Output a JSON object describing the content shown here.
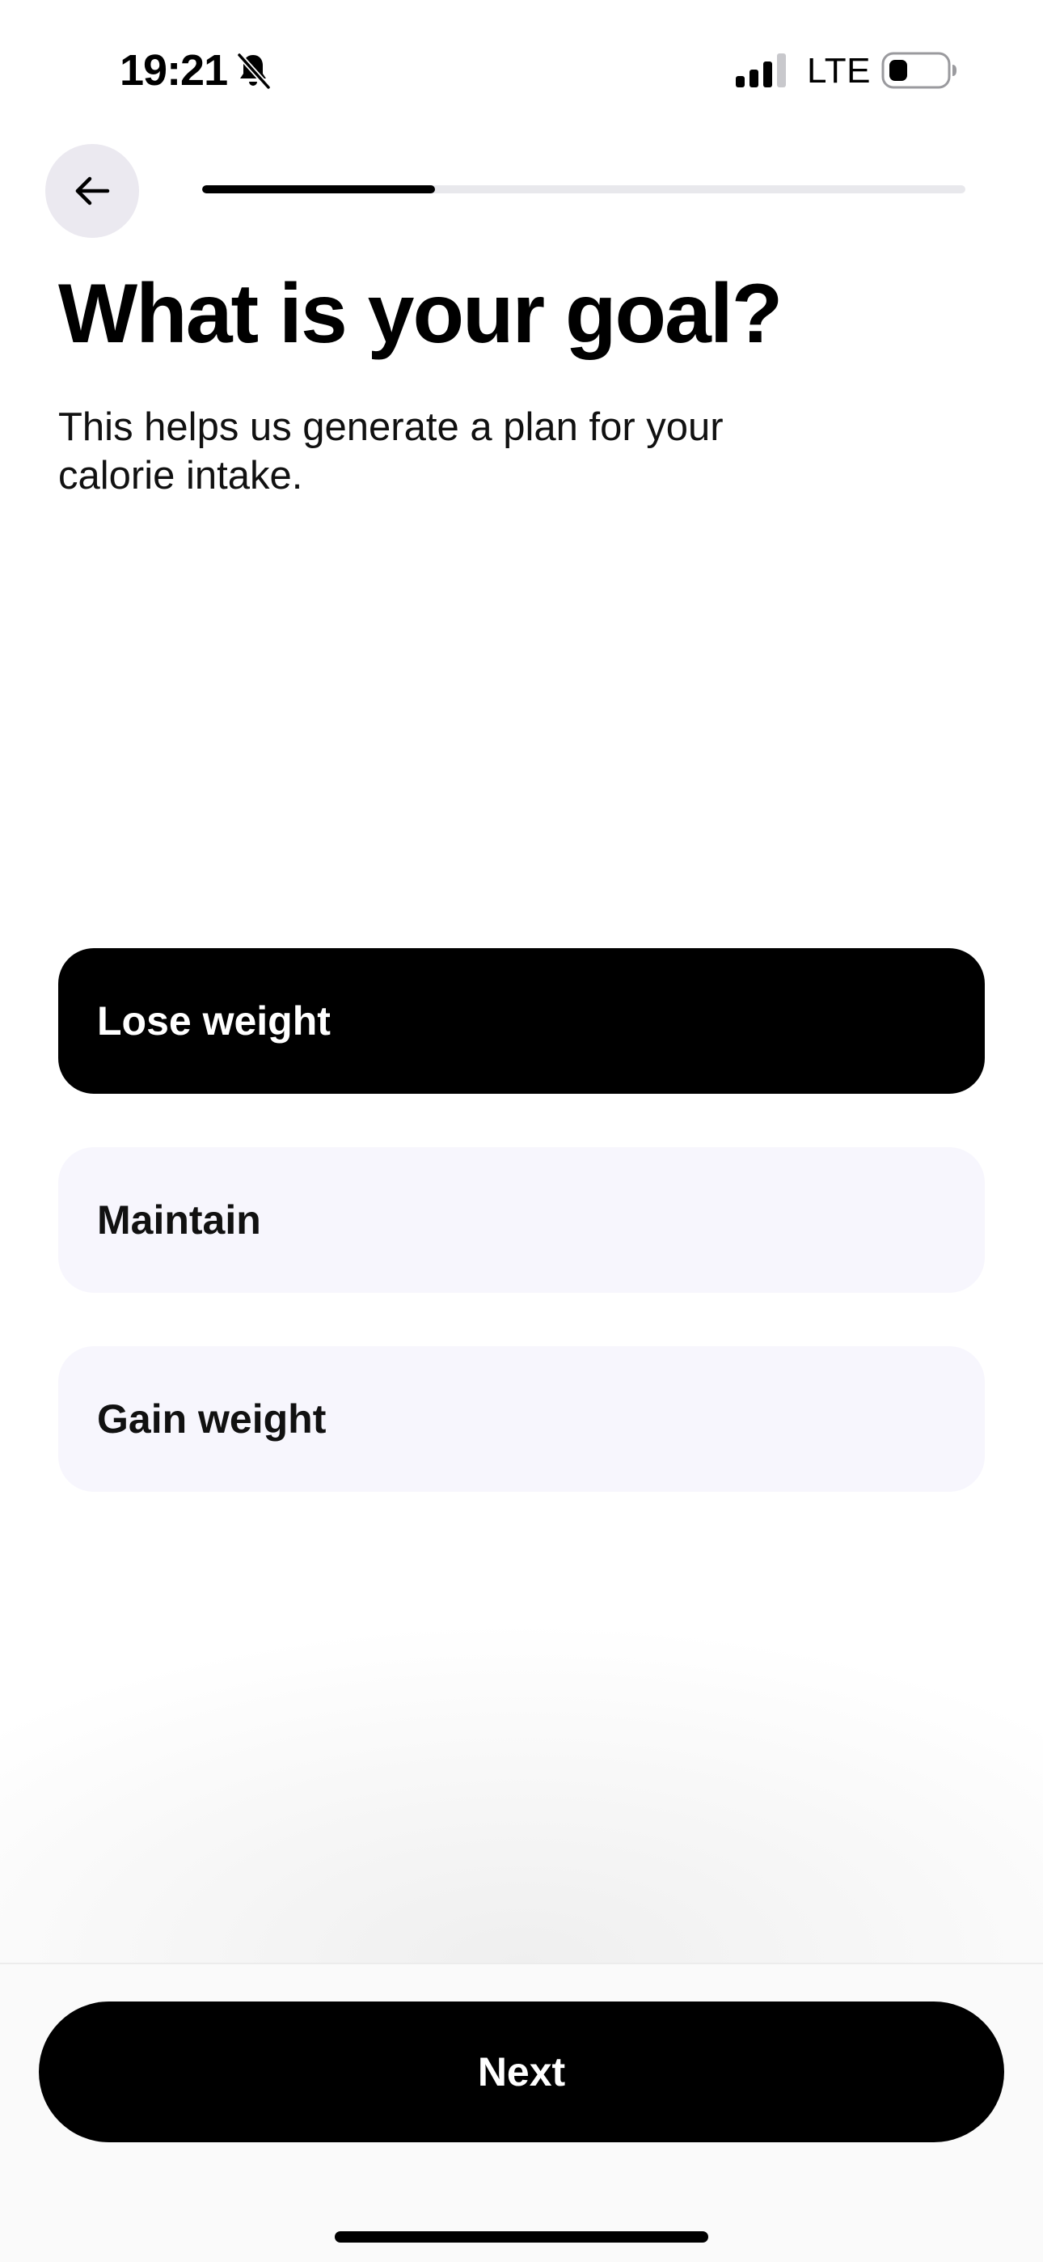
{
  "status_bar": {
    "time": "19:21",
    "network": "LTE",
    "icons": [
      "bell-muted-icon",
      "signal-icon",
      "battery-icon"
    ]
  },
  "header": {
    "back_icon": "arrow-left-icon",
    "progress": 0.305
  },
  "content": {
    "title": "What is your goal?",
    "subtitle": "This helps us generate a plan for your calorie intake."
  },
  "options": [
    {
      "label": "Lose weight",
      "selected": true
    },
    {
      "label": "Maintain",
      "selected": false
    },
    {
      "label": "Gain weight",
      "selected": false
    }
  ],
  "footer": {
    "next_label": "Next"
  },
  "colors": {
    "accent": "#000000",
    "option_bg": "#f7f6fd",
    "back_button_bg": "#ebe9f0",
    "progress_track": "#e8e8ec"
  }
}
